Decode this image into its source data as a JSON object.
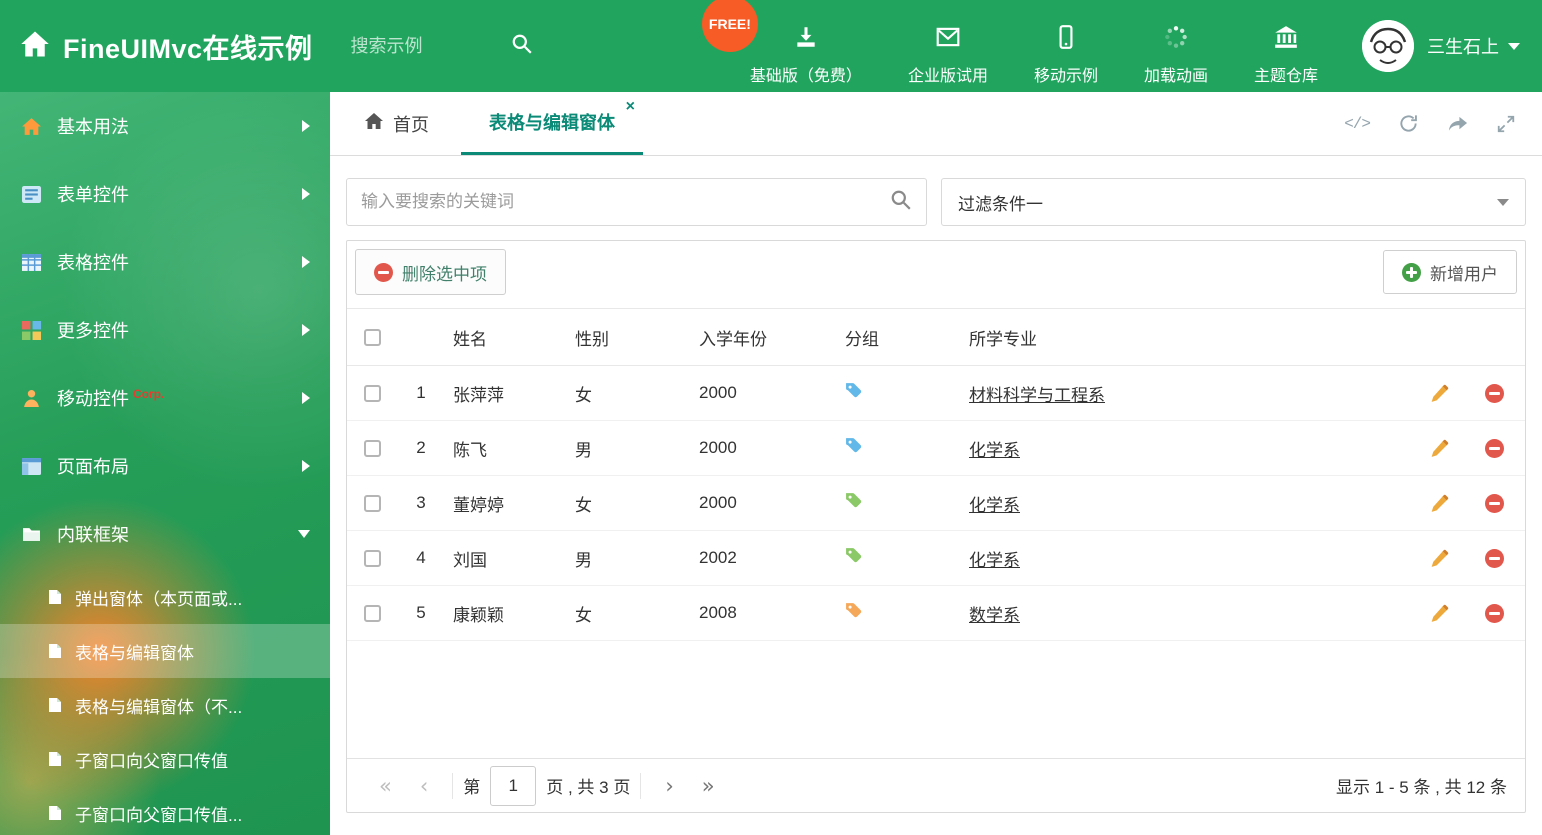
{
  "brand": {
    "title": "FineUIMvc在线示例"
  },
  "header": {
    "search_placeholder": "搜索示例",
    "free_badge": "FREE!",
    "nav": [
      {
        "label": "基础版（免费）",
        "icon": "download-icon"
      },
      {
        "label": "企业版试用",
        "icon": "envelope-icon"
      },
      {
        "label": "移动示例",
        "icon": "mobile-icon"
      },
      {
        "label": "加载动画",
        "icon": "spinner-icon"
      },
      {
        "label": "主题仓库",
        "icon": "bank-icon"
      }
    ],
    "user": {
      "name": "三生石上"
    }
  },
  "sidebar": {
    "items": [
      {
        "label": "基本用法",
        "icon": "home-icon"
      },
      {
        "label": "表单控件",
        "icon": "form-icon"
      },
      {
        "label": "表格控件",
        "icon": "table-icon"
      },
      {
        "label": "更多控件",
        "icon": "blocks-icon"
      },
      {
        "label": "移动控件",
        "badge": "Corp.",
        "icon": "person-icon"
      },
      {
        "label": "页面布局",
        "icon": "layout-icon"
      },
      {
        "label": "内联框架",
        "icon": "folder-icon",
        "expanded": true
      }
    ],
    "subitems": [
      {
        "label": "弹出窗体（本页面或..."
      },
      {
        "label": "表格与编辑窗体",
        "active": true
      },
      {
        "label": "表格与编辑窗体（不..."
      },
      {
        "label": "子窗口向父窗口传值"
      },
      {
        "label": "子窗口向父窗口传值..."
      }
    ]
  },
  "tabs": {
    "home": "首页",
    "active": "表格与编辑窗体"
  },
  "filter": {
    "search_placeholder": "输入要搜索的关键词",
    "dropdown_value": "过滤条件一"
  },
  "toolbar": {
    "delete_label": "删除选中项",
    "add_label": "新增用户"
  },
  "table": {
    "columns": {
      "name": "姓名",
      "gender": "性别",
      "year": "入学年份",
      "group": "分组",
      "major": "所学专业"
    },
    "rows": [
      {
        "num": "1",
        "name": "张萍萍",
        "gender": "女",
        "year": "2000",
        "tag_color": "#62b8e8",
        "major": "材料科学与工程系"
      },
      {
        "num": "2",
        "name": "陈飞",
        "gender": "男",
        "year": "2000",
        "tag_color": "#62b8e8",
        "major": "化学系"
      },
      {
        "num": "3",
        "name": "董婷婷",
        "gender": "女",
        "year": "2000",
        "tag_color": "#8bc867",
        "major": "化学系"
      },
      {
        "num": "4",
        "name": "刘国",
        "gender": "男",
        "year": "2002",
        "tag_color": "#8bc867",
        "major": "化学系"
      },
      {
        "num": "5",
        "name": "康颖颖",
        "gender": "女",
        "year": "2008",
        "tag_color": "#f5a85a",
        "major": "数学系"
      }
    ]
  },
  "pagination": {
    "prefix": "第",
    "current_page": "1",
    "suffix": "页 , 共 3 页",
    "summary": "显示 1 - 5 条 , 共 12 条"
  },
  "colors": {
    "header_green": "#21a55e",
    "active_tab_teal": "#0a8a77",
    "free_badge_orange": "#f75b26",
    "delete_red": "#e2574c",
    "add_green": "#43a047",
    "edit_pencil_orange": "#eda93b"
  }
}
